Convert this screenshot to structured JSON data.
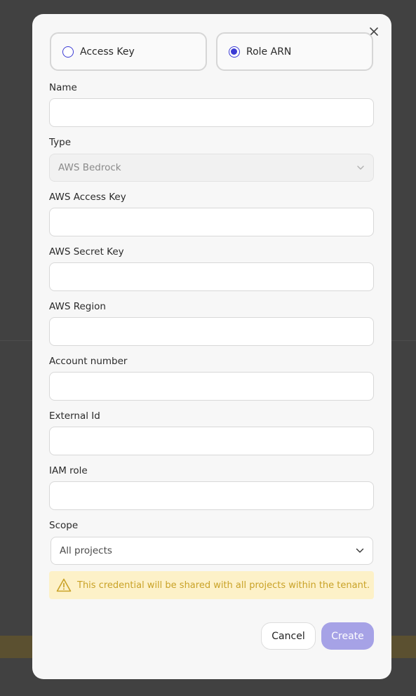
{
  "auth_method": {
    "options": [
      {
        "label": "Access Key",
        "selected": false
      },
      {
        "label": "Role ARN",
        "selected": true
      }
    ]
  },
  "fields": {
    "name": {
      "label": "Name",
      "value": ""
    },
    "type": {
      "label": "Type",
      "value": "AWS Bedrock"
    },
    "aws_access_key": {
      "label": "AWS Access Key",
      "value": ""
    },
    "aws_secret_key": {
      "label": "AWS Secret Key",
      "value": ""
    },
    "aws_region": {
      "label": "AWS Region",
      "value": ""
    },
    "account_number": {
      "label": "Account number",
      "value": ""
    },
    "external_id": {
      "label": "External Id",
      "value": ""
    },
    "iam_role": {
      "label": "IAM role",
      "value": ""
    },
    "scope": {
      "label": "Scope",
      "value": "All projects"
    }
  },
  "warning": {
    "text": "This credential will be shared with all projects within the tenant.",
    "icon": "warning-triangle-icon",
    "color": "#c9a227"
  },
  "buttons": {
    "cancel_label": "Cancel",
    "create_label": "Create"
  },
  "colors": {
    "accent": "#3b3bd4",
    "create_button": "#a6a2e6",
    "warning_bg": "#fdf1c8"
  }
}
